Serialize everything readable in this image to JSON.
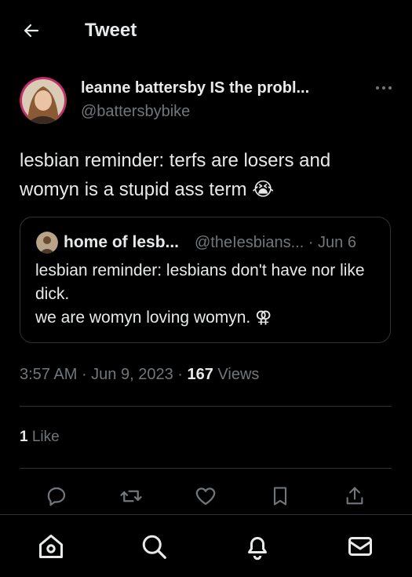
{
  "header": {
    "title": "Tweet"
  },
  "tweet": {
    "display_name": "leanne battersby IS the probl...",
    "handle": "@battersbybike",
    "text": "lesbian reminder: terfs are losers and womyn is a stupid ass term 😭"
  },
  "quote": {
    "display_name": "home of lesb...",
    "handle_date": "@theIesbians... · Jun 6",
    "text": "lesbian reminder: lesbians don't have nor like dick.\nwe are womyn loving womyn. ⚢"
  },
  "meta": {
    "time": "3:57 AM",
    "sep1": " · ",
    "date": "Jun 9, 2023",
    "sep2": " · ",
    "views_count": "167",
    "views_label": " Views"
  },
  "likes": {
    "count": "1",
    "label": " Like"
  },
  "icons": {
    "back": "arrow-left-icon",
    "more": "more-dots-icon",
    "actions": [
      "reply-icon",
      "retweet-icon",
      "like-icon",
      "bookmark-icon",
      "share-icon"
    ],
    "nav": [
      "home-icon",
      "search-icon",
      "notifications-icon",
      "messages-icon"
    ]
  },
  "colors": {
    "background": "#000000",
    "text": "#e7e9ea",
    "secondary": "#71767b",
    "divider": "#2f3336"
  }
}
